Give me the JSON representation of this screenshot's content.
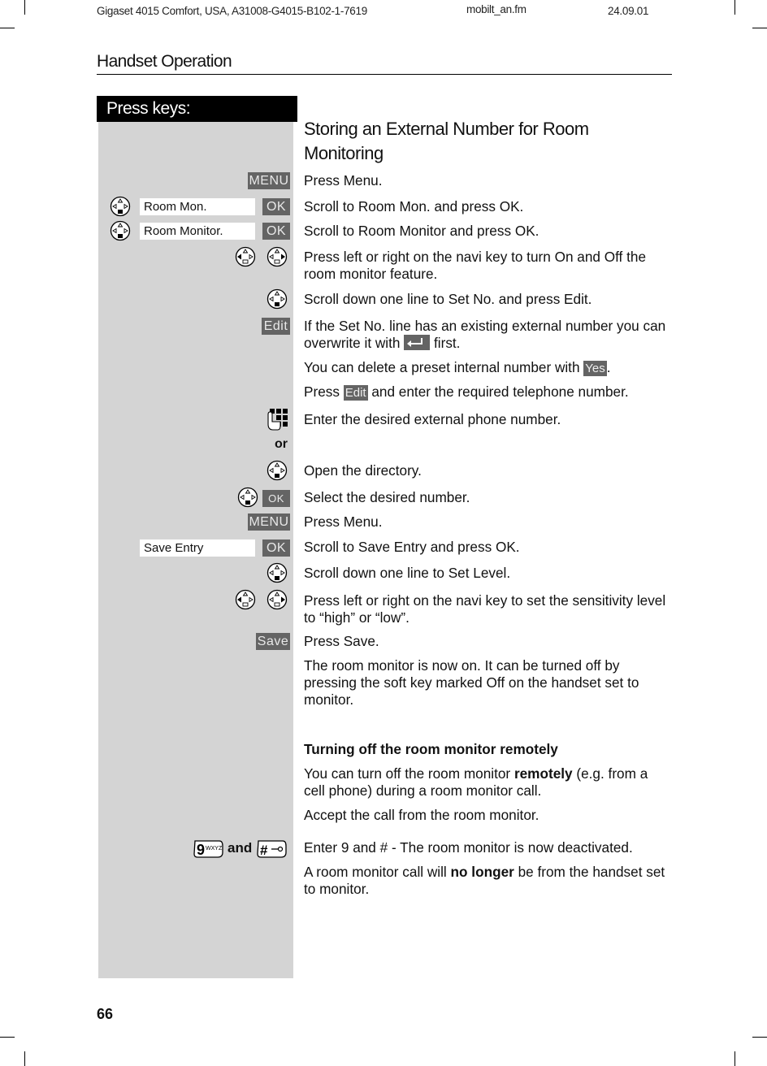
{
  "header": {
    "doc_id": "Gigaset 4015 Comfort, USA, A31008-G4015-B102-1-7619",
    "file": "mobilt_an.fm",
    "date": "24.09.01"
  },
  "section_title": "Handset Operation",
  "keys_heading": "Press keys:",
  "page_number": "66",
  "steps_title": "Storing an External Number for Room Monitoring",
  "keys": {
    "menu": "MENU",
    "ok": "OK",
    "edit": "Edit",
    "yes": "Yes",
    "save": "Save",
    "nine": "9",
    "nine_sub": "WXYZ",
    "and": "and",
    "hash": "#",
    "or": "or"
  },
  "displays": {
    "room_mon": "Room Mon.",
    "room_monitor": "Room Monitor.",
    "save_entry": "Save Entry"
  },
  "steps": [
    {
      "id": "press-menu",
      "text": "Press Menu."
    },
    {
      "id": "scroll-room-mon",
      "text": "Scroll to Room Mon. and press OK."
    },
    {
      "id": "scroll-room-monitor",
      "text": "Scroll to Room Monitor and press OK."
    },
    {
      "id": "toggle-on-off",
      "text": "Press left or right on the navi key to turn On and Off the room monitor feature."
    },
    {
      "id": "scroll-set-no",
      "text": "Scroll down one line to Set No. and press Edit."
    },
    {
      "id": "overwrite-a",
      "text": "If the Set No. line has an existing external number you can overwrite it with"
    },
    {
      "id": "overwrite-b",
      "text": "first."
    },
    {
      "id": "delete-preset-a",
      "text": "You can delete a preset internal number with"
    },
    {
      "id": "press-edit-a",
      "text": "Press"
    },
    {
      "id": "press-edit-b",
      "text": "and enter the required telephone number."
    },
    {
      "id": "enter-number",
      "text": "Enter the desired external phone number."
    },
    {
      "id": "open-directory",
      "text": "Open the directory."
    },
    {
      "id": "select-number",
      "text": "Select the desired number."
    },
    {
      "id": "press-menu-2",
      "text": "Press Menu."
    },
    {
      "id": "scroll-save-entry",
      "text": "Scroll to Save Entry and press OK."
    },
    {
      "id": "scroll-set-level",
      "text": "Scroll down one line to Set Level."
    },
    {
      "id": "set-sensitivity",
      "text": "Press left or right on the navi key to set the sensitivity level to “high” or “low”."
    },
    {
      "id": "press-save",
      "text": "Press Save."
    },
    {
      "id": "monitor-on",
      "text": "The room monitor is now on.  It can be turned off by pressing the soft key marked Off on the handset set to monitor."
    }
  ],
  "remote_section": {
    "title": "Turning off the room monitor remotely",
    "intro_a": "You can turn off the room monitor",
    "intro_bold": "remotely",
    "intro_b": "(e.g. from a cell phone) during a room monitor call.",
    "accept": "Accept the call from the room monitor.",
    "enter": "Enter 9 and # - The room monitor is now deactivated.",
    "note_a": "A room monitor call will",
    "note_bold": "no longer",
    "note_b": "be from the handset set to monitor."
  }
}
